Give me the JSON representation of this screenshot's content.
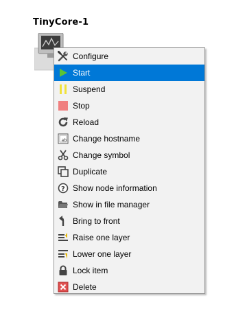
{
  "node": {
    "name": "TinyCore-1"
  },
  "menu": {
    "items": [
      {
        "label": "Configure",
        "icon": "wrench-screwdriver-icon"
      },
      {
        "label": "Start",
        "icon": "play-icon",
        "highlighted": true
      },
      {
        "label": "Suspend",
        "icon": "pause-icon"
      },
      {
        "label": "Stop",
        "icon": "stop-icon"
      },
      {
        "label": "Reload",
        "icon": "reload-icon"
      },
      {
        "label": "Change hostname",
        "icon": "hostname-icon"
      },
      {
        "label": "Change symbol",
        "icon": "scissors-icon"
      },
      {
        "label": "Duplicate",
        "icon": "duplicate-icon"
      },
      {
        "label": "Show node information",
        "icon": "question-icon"
      },
      {
        "label": "Show in file manager",
        "icon": "folder-icon"
      },
      {
        "label": "Bring to front",
        "icon": "bring-front-icon"
      },
      {
        "label": "Raise one layer",
        "icon": "raise-layer-icon"
      },
      {
        "label": "Lower one layer",
        "icon": "lower-layer-icon"
      },
      {
        "label": "Lock item",
        "icon": "lock-icon"
      },
      {
        "label": "Delete",
        "icon": "delete-icon"
      }
    ]
  },
  "colors": {
    "highlight": "#0078d7",
    "menu_background": "#f2f2f2",
    "menu_border": "#979797"
  }
}
